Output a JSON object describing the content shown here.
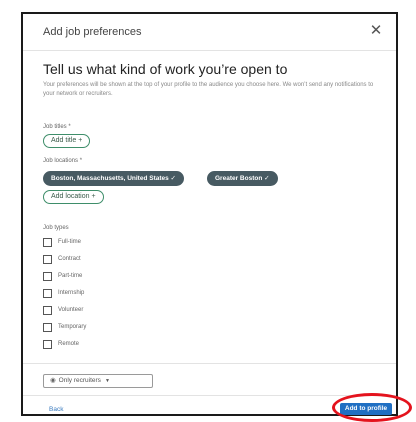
{
  "modal": {
    "title": "Add job preferences",
    "close_icon": "close-icon"
  },
  "main": {
    "heading": "Tell us what kind of work you’re open to",
    "intro": "Your preferences will be shown at the top of your profile to the audience you choose here. We won’t send any notifications to your network or recruiters."
  },
  "job_titles": {
    "label": "Job titles *",
    "add_label": "Add title +"
  },
  "job_locations": {
    "label": "Job locations *",
    "selected": [
      "Boston, Massachusetts, United States ✓",
      "Greater Boston ✓"
    ],
    "add_label": "Add location +"
  },
  "job_types": {
    "label": "Job types",
    "options": [
      "Full-time",
      "Contract",
      "Part-time",
      "Internship",
      "Volunteer",
      "Temporary",
      "Remote"
    ]
  },
  "footer": {
    "visibility_icon": "eye-icon",
    "visibility_label": "Only recruiters",
    "visibility_caret": "▼",
    "back_label": "Back",
    "submit_label": "Add to profile"
  },
  "colors": {
    "primary": "#1f6fc3",
    "pill_filled": "#475a62",
    "pill_outline": "#3e8e6a",
    "annotation": "#e4131d"
  }
}
